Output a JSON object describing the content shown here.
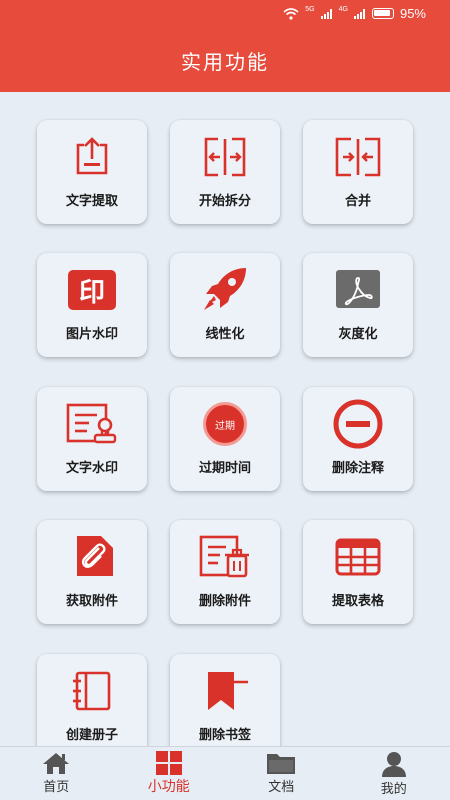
{
  "status_bar": {
    "signal_1": "5G",
    "signal_2": "4G",
    "battery": "95%"
  },
  "header": {
    "title": "实用功能"
  },
  "features": [
    {
      "label": "文字提取",
      "icon": "text-extract-icon"
    },
    {
      "label": "开始拆分",
      "icon": "split-icon"
    },
    {
      "label": "合并",
      "icon": "merge-icon"
    },
    {
      "label": "图片水印",
      "icon": "image-watermark-icon",
      "icon_text": "印"
    },
    {
      "label": "线性化",
      "icon": "rocket-icon"
    },
    {
      "label": "灰度化",
      "icon": "pdf-gray-icon"
    },
    {
      "label": "文字水印",
      "icon": "text-watermark-icon"
    },
    {
      "label": "过期时间",
      "icon": "expiry-icon",
      "icon_text": "过期"
    },
    {
      "label": "删除注释",
      "icon": "delete-comment-icon"
    },
    {
      "label": "获取附件",
      "icon": "attachment-icon"
    },
    {
      "label": "删除附件",
      "icon": "delete-attachment-icon"
    },
    {
      "label": "提取表格",
      "icon": "table-icon"
    },
    {
      "label": "创建册子",
      "icon": "booklet-icon"
    },
    {
      "label": "删除书签",
      "icon": "delete-bookmark-icon"
    }
  ],
  "bottom_nav": [
    {
      "label": "首页",
      "icon": "home-icon",
      "active": false
    },
    {
      "label": "小功能",
      "icon": "grid-icon",
      "active": true
    },
    {
      "label": "文档",
      "icon": "folder-icon",
      "active": false
    },
    {
      "label": "我的",
      "icon": "user-icon",
      "active": false
    }
  ],
  "colors": {
    "accent": "#e64b3c",
    "icon_red": "#d9322a",
    "background": "#e6edf5",
    "card": "#edf2f8"
  }
}
